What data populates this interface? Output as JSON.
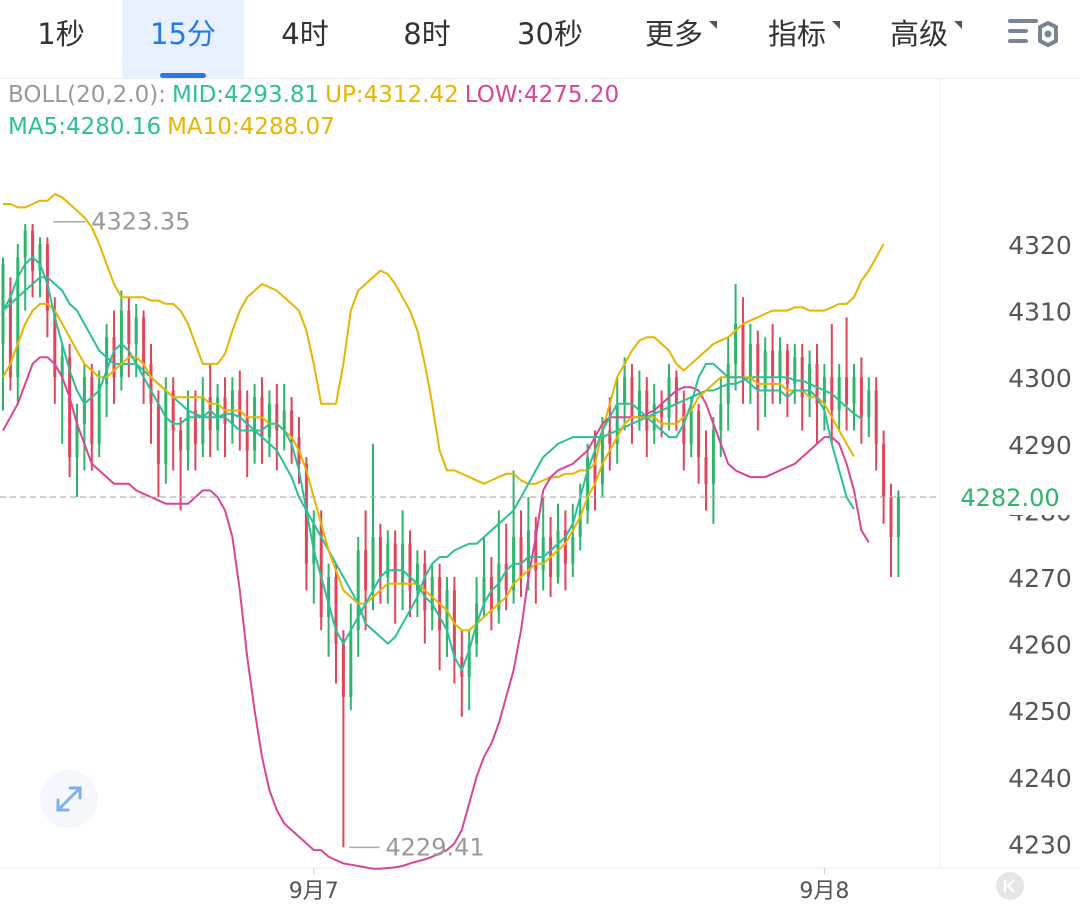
{
  "tabs": [
    {
      "label": "1秒"
    },
    {
      "label": "15分",
      "active": true
    },
    {
      "label": "4时"
    },
    {
      "label": "8时"
    },
    {
      "label": "30秒"
    },
    {
      "label": "更多",
      "dropdown": true
    },
    {
      "label": "指标",
      "dropdown": true
    },
    {
      "label": "高级",
      "dropdown": true
    }
  ],
  "settings_icon": "settings-icon",
  "legend": {
    "boll_label": "BOLL(20,2.0):",
    "mid": "MID:4293.81",
    "up": "UP:4312.42",
    "low": "LOW:4275.20",
    "ma5": "MA5:4280.16",
    "ma10": "MA10:4288.07"
  },
  "colors": {
    "up_candle": "#2db56a",
    "down_candle": "#e0455a",
    "mid": "#2bbf9a",
    "up": "#e8b400",
    "low": "#d9449a",
    "ma5": "#2bbf9a",
    "ma10": "#e8b400",
    "boll_label": "#999999",
    "price_tag": "#2db56a",
    "active_tab": "#2a78e8"
  },
  "chart_data": {
    "type": "candlestick",
    "ylim": [
      4226,
      4334
    ],
    "y_ticks": [
      4230,
      4240,
      4250,
      4260,
      4270,
      4280,
      4290,
      4300,
      4310,
      4320
    ],
    "x_ticks": [
      {
        "label": "9月7",
        "index": 42
      },
      {
        "label": "9月8",
        "index": 111
      }
    ],
    "current_price": "4282.00",
    "max_label": "4323.35",
    "min_label": "4229.41",
    "candles": [
      [
        4305,
        4317,
        4295,
        4318
      ],
      [
        4312,
        4300,
        4298,
        4315
      ],
      [
        4300,
        4318,
        4296,
        4320
      ],
      [
        4318,
        4322,
        4310,
        4323
      ],
      [
        4322,
        4316,
        4312,
        4323
      ],
      [
        4316,
        4320,
        4312,
        4321
      ],
      [
        4320,
        4310,
        4306,
        4321
      ],
      [
        4310,
        4300,
        4296,
        4312
      ],
      [
        4300,
        4303,
        4290,
        4305
      ],
      [
        4303,
        4288,
        4285,
        4305
      ],
      [
        4288,
        4293,
        4282,
        4296
      ],
      [
        4293,
        4300,
        4286,
        4302
      ],
      [
        4300,
        4290,
        4286,
        4302
      ],
      [
        4290,
        4299,
        4288,
        4301
      ],
      [
        4299,
        4306,
        4294,
        4308
      ],
      [
        4306,
        4300,
        4296,
        4310
      ],
      [
        4300,
        4310,
        4298,
        4313
      ],
      [
        4310,
        4305,
        4300,
        4312
      ],
      [
        4305,
        4309,
        4300,
        4311
      ],
      [
        4309,
        4302,
        4296,
        4310
      ],
      [
        4302,
        4296,
        4290,
        4305
      ],
      [
        4296,
        4287,
        4282,
        4298
      ],
      [
        4287,
        4298,
        4284,
        4300
      ],
      [
        4298,
        4292,
        4286,
        4300
      ],
      [
        4292,
        4289,
        4280,
        4294
      ],
      [
        4289,
        4295,
        4286,
        4298
      ],
      [
        4295,
        4290,
        4286,
        4298
      ],
      [
        4290,
        4297,
        4288,
        4300
      ],
      [
        4297,
        4292,
        4288,
        4302
      ],
      [
        4292,
        4297,
        4289,
        4299
      ],
      [
        4297,
        4293,
        4288,
        4300
      ],
      [
        4293,
        4298,
        4290,
        4300
      ],
      [
        4298,
        4294,
        4289,
        4301
      ],
      [
        4294,
        4289,
        4285,
        4298
      ],
      [
        4289,
        4297,
        4287,
        4299
      ],
      [
        4297,
        4291,
        4287,
        4300
      ],
      [
        4291,
        4296,
        4288,
        4298
      ],
      [
        4296,
        4292,
        4286,
        4299
      ],
      [
        4292,
        4295,
        4289,
        4299
      ],
      [
        4295,
        4291,
        4287,
        4297
      ],
      [
        4291,
        4287,
        4284,
        4294
      ],
      [
        4287,
        4272,
        4268,
        4288
      ],
      [
        4272,
        4278,
        4266,
        4280
      ],
      [
        4278,
        4264,
        4262,
        4280
      ],
      [
        4264,
        4270,
        4258,
        4272
      ],
      [
        4270,
        4260,
        4254,
        4272
      ],
      [
        4260,
        4252,
        4229.41,
        4262
      ],
      [
        4252,
        4262,
        4250,
        4266
      ],
      [
        4262,
        4274,
        4258,
        4276
      ],
      [
        4274,
        4268,
        4262,
        4280
      ],
      [
        4268,
        4276,
        4265,
        4290
      ],
      [
        4276,
        4270,
        4266,
        4278
      ],
      [
        4270,
        4275,
        4266,
        4277
      ],
      [
        4275,
        4269,
        4263,
        4277
      ],
      [
        4269,
        4275,
        4265,
        4280
      ],
      [
        4275,
        4268,
        4264,
        4277
      ],
      [
        4268,
        4272,
        4264,
        4274
      ],
      [
        4272,
        4265,
        4260,
        4274
      ],
      [
        4265,
        4270,
        4262,
        4272
      ],
      [
        4270,
        4262,
        4256,
        4272
      ],
      [
        4262,
        4268,
        4258,
        4270
      ],
      [
        4268,
        4258,
        4254,
        4270
      ],
      [
        4258,
        4255,
        4249,
        4262
      ],
      [
        4255,
        4260,
        4250,
        4262
      ],
      [
        4260,
        4266,
        4258,
        4270
      ],
      [
        4266,
        4270,
        4264,
        4276
      ],
      [
        4270,
        4265,
        4262,
        4273
      ],
      [
        4265,
        4272,
        4263,
        4280
      ],
      [
        4272,
        4268,
        4265,
        4278
      ],
      [
        4268,
        4276,
        4266,
        4286
      ],
      [
        4276,
        4270,
        4267,
        4280
      ],
      [
        4270,
        4277,
        4268,
        4282
      ],
      [
        4277,
        4271,
        4266,
        4279
      ],
      [
        4271,
        4276,
        4268,
        4282
      ],
      [
        4276,
        4270,
        4267,
        4279
      ],
      [
        4270,
        4277,
        4269,
        4281
      ],
      [
        4277,
        4272,
        4268,
        4280
      ],
      [
        4272,
        4276,
        4270,
        4281
      ],
      [
        4276,
        4280,
        4274,
        4284
      ],
      [
        4280,
        4288,
        4278,
        4290
      ],
      [
        4288,
        4284,
        4280,
        4292
      ],
      [
        4284,
        4292,
        4282,
        4294
      ],
      [
        4292,
        4290,
        4286,
        4297
      ],
      [
        4290,
        4296,
        4287,
        4300
      ],
      [
        4296,
        4300,
        4292,
        4303
      ],
      [
        4300,
        4294,
        4290,
        4302
      ],
      [
        4294,
        4298,
        4292,
        4301
      ],
      [
        4298,
        4292,
        4288,
        4300
      ],
      [
        4292,
        4296,
        4290,
        4299
      ],
      [
        4296,
        4294,
        4291,
        4298
      ],
      [
        4294,
        4300,
        4292,
        4302
      ],
      [
        4300,
        4296,
        4292,
        4301
      ],
      [
        4296,
        4290,
        4286,
        4298
      ],
      [
        4290,
        4295,
        4288,
        4297
      ],
      [
        4295,
        4288,
        4284,
        4296
      ],
      [
        4288,
        4284,
        4280,
        4292
      ],
      [
        4284,
        4292,
        4278,
        4294
      ],
      [
        4292,
        4296,
        4288,
        4300
      ],
      [
        4296,
        4302,
        4292,
        4306
      ],
      [
        4302,
        4308,
        4298,
        4314
      ],
      [
        4308,
        4300,
        4296,
        4312
      ],
      [
        4300,
        4305,
        4296,
        4308
      ],
      [
        4305,
        4298,
        4292,
        4307
      ],
      [
        4298,
        4304,
        4294,
        4306
      ],
      [
        4304,
        4300,
        4296,
        4308
      ],
      [
        4300,
        4304,
        4296,
        4306
      ],
      [
        4304,
        4299,
        4294,
        4305
      ],
      [
        4299,
        4303,
        4296,
        4305
      ],
      [
        4303,
        4297,
        4292,
        4305
      ],
      [
        4297,
        4302,
        4294,
        4304
      ],
      [
        4302,
        4296,
        4290,
        4305
      ],
      [
        4296,
        4300,
        4292,
        4302
      ],
      [
        4300,
        4295,
        4290,
        4308
      ],
      [
        4295,
        4300,
        4292,
        4302
      ],
      [
        4300,
        4296,
        4292,
        4309
      ],
      [
        4296,
        4300,
        4292,
        4302
      ],
      [
        4300,
        4294,
        4290,
        4303
      ],
      [
        4294,
        4298,
        4291,
        4300
      ],
      [
        4298,
        4290,
        4286,
        4300
      ],
      [
        4290,
        4282,
        4278,
        4292
      ],
      [
        4282,
        4276,
        4270,
        4284
      ],
      [
        4276,
        4282,
        4270,
        4283
      ]
    ],
    "boll_up": [
      4326,
      4326,
      4325.5,
      4325.5,
      4326,
      4326.5,
      4326.5,
      4327.5,
      4327,
      4326,
      4325,
      4324,
      4322.5,
      4320,
      4317,
      4314,
      4312,
      4312,
      4312,
      4312,
      4311.5,
      4311.5,
      4311,
      4311,
      4310,
      4308,
      4305,
      4302,
      4302,
      4302,
      4303.5,
      4307,
      4310,
      4312,
      4313,
      4314,
      4313.5,
      4313,
      4312,
      4311,
      4310,
      4307,
      4302,
      4296,
      4296,
      4296,
      4302,
      4310,
      4313,
      4314,
      4315,
      4316,
      4315.5,
      4314,
      4312,
      4310,
      4307,
      4302,
      4296,
      4289,
      4286,
      4286,
      4285.5,
      4285,
      4284.5,
      4284,
      4284.5,
      4285,
      4285.5,
      4285.5,
      4284.5,
      4284,
      4284,
      4284.5,
      4285,
      4285,
      4285.5,
      4285.5,
      4286,
      4286,
      4287,
      4292,
      4296,
      4300,
      4302,
      4304,
      4305.5,
      4306,
      4306,
      4305,
      4304,
      4302,
      4301,
      4302,
      4303,
      4304,
      4305,
      4305.5,
      4306,
      4307,
      4308,
      4308.5,
      4309,
      4309.5,
      4310,
      4310,
      4310,
      4310.5,
      4310.5,
      4310,
      4310,
      4310,
      4310.5,
      4311,
      4311,
      4312,
      4314.5,
      4316,
      4318,
      4320
    ],
    "boll_mid": [
      4310,
      4311,
      4312,
      4313,
      4314,
      4315,
      4315,
      4314,
      4313,
      4311,
      4310,
      4308,
      4306,
      4304,
      4303,
      4302,
      4302,
      4302,
      4302,
      4301,
      4300,
      4299,
      4298,
      4297,
      4296,
      4295,
      4294.5,
      4294,
      4294,
      4294,
      4294.5,
      4294.5,
      4294,
      4293,
      4292,
      4291,
      4290,
      4289,
      4287,
      4285,
      4282,
      4280,
      4278,
      4276,
      4274,
      4272,
      4270,
      4268,
      4266,
      4263,
      4262,
      4261,
      4260,
      4261,
      4263,
      4265,
      4267,
      4270,
      4272,
      4273,
      4273,
      4274,
      4274.5,
      4275,
      4275,
      4276,
      4277,
      4278,
      4279,
      4280,
      4282,
      4284,
      4286,
      4288,
      4289,
      4290,
      4290.5,
      4291,
      4291,
      4291,
      4291,
      4291,
      4291.5,
      4292,
      4292.5,
      4293,
      4293.5,
      4294,
      4294.5,
      4295,
      4295.5,
      4296,
      4296.5,
      4297,
      4297.5,
      4298,
      4298,
      4298.5,
      4299,
      4299,
      4299.5,
      4300,
      4300,
      4300,
      4300,
      4300,
      4300,
      4299.5,
      4299.5,
      4299,
      4298.5,
      4298,
      4297.5,
      4296.5,
      4295.5,
      4294.5,
      4293.8
    ],
    "boll_low": [
      4292,
      4294,
      4296,
      4299,
      4302,
      4303,
      4303,
      4302,
      4300,
      4297,
      4293,
      4290,
      4287,
      4286,
      4285,
      4284,
      4284,
      4284,
      4283,
      4282.5,
      4282,
      4281.5,
      4281,
      4281,
      4281,
      4281,
      4282,
      4283,
      4283,
      4282,
      4280,
      4276,
      4268,
      4258,
      4250,
      4243,
      4238,
      4235,
      4233,
      4232,
      4231,
      4230,
      4229,
      4229,
      4228,
      4227.5,
      4227,
      4226.8,
      4226.6,
      4226.4,
      4226.2,
      4226.2,
      4226.3,
      4226.4,
      4226.6,
      4227,
      4227.3,
      4227.6,
      4228,
      4228.5,
      4229,
      4230,
      4232,
      4236,
      4240,
      4243,
      4245,
      4248,
      4252,
      4256,
      4262,
      4270,
      4276,
      4283,
      4285,
      4286,
      4286.5,
      4287,
      4288,
      4289,
      4291,
      4293,
      4294,
      4294,
      4294,
      4294,
      4294,
      4294.5,
      4295,
      4296,
      4297,
      4298,
      4298.5,
      4298.5,
      4298,
      4296,
      4293,
      4290,
      4287,
      4286,
      4285.5,
      4285,
      4285,
      4285,
      4285.5,
      4286,
      4286.5,
      4287,
      4288,
      4289,
      4290,
      4291,
      4291,
      4290,
      4287,
      4283,
      4277,
      4275.2
    ],
    "ma5": [
      4310,
      4312,
      4315,
      4317,
      4318,
      4317,
      4314,
      4309,
      4305,
      4301,
      4298,
      4296,
      4297,
      4298,
      4301,
      4304,
      4305,
      4304,
      4302,
      4300,
      4298,
      4296,
      4294,
      4293,
      4293,
      4294,
      4294,
      4294,
      4295,
      4294,
      4294,
      4293,
      4292,
      4292,
      4292,
      4292,
      4293,
      4293,
      4292,
      4290,
      4286,
      4280,
      4274,
      4270,
      4266,
      4262,
      4260,
      4262,
      4264,
      4266,
      4268,
      4270,
      4271,
      4271,
      4271,
      4270,
      4269,
      4267,
      4266,
      4264,
      4262,
      4258,
      4256,
      4259,
      4263,
      4266,
      4268,
      4269,
      4271,
      4272,
      4272,
      4273,
      4273,
      4273,
      4274,
      4275,
      4276,
      4278,
      4282,
      4286,
      4289,
      4292,
      4294,
      4296,
      4296,
      4296,
      4295,
      4294,
      4293,
      4292,
      4291,
      4291,
      4293,
      4296,
      4300,
      4302,
      4302,
      4301,
      4300,
      4300,
      4300,
      4299,
      4298,
      4298,
      4298,
      4298,
      4297,
      4298,
      4298,
      4298,
      4297,
      4295,
      4290,
      4286,
      4282,
      4280.2
    ],
    "ma10": [
      4300,
      4302,
      4305,
      4308,
      4310,
      4311,
      4311,
      4310,
      4308,
      4306,
      4304,
      4302,
      4301,
      4300,
      4300,
      4301,
      4302,
      4303,
      4303,
      4302,
      4300,
      4299,
      4298,
      4297,
      4297,
      4297,
      4297,
      4297,
      4296,
      4296,
      4295,
      4295,
      4295,
      4294,
      4294,
      4294,
      4293,
      4293,
      4292,
      4291,
      4289,
      4286,
      4282,
      4278,
      4274,
      4271,
      4268,
      4267,
      4266,
      4266,
      4267,
      4268,
      4269,
      4269,
      4269,
      4269,
      4269,
      4268,
      4267,
      4266,
      4265,
      4263,
      4262,
      4262,
      4263,
      4264,
      4265,
      4266,
      4267,
      4269,
      4270,
      4271,
      4272,
      4272,
      4273,
      4274,
      4275,
      4277,
      4279,
      4282,
      4284,
      4287,
      4289,
      4291,
      4293,
      4294,
      4294,
      4294,
      4294,
      4293,
      4293,
      4293,
      4294,
      4295,
      4297,
      4298,
      4299,
      4300,
      4300,
      4300,
      4300,
      4300,
      4299,
      4299,
      4299,
      4299,
      4298,
      4298,
      4298,
      4297,
      4297,
      4296,
      4294,
      4292,
      4290,
      4288.1
    ]
  }
}
